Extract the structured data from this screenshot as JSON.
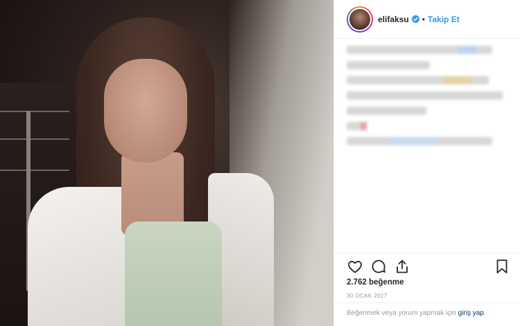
{
  "header": {
    "username": "elifaksu",
    "follow_label": "Takip Et",
    "separator": "•"
  },
  "footer": {
    "likes": "2.762 beğenme",
    "date": "30 OCAK 2017",
    "login_prefix": "Beğenmek veya yorum yapmak için",
    "login_link": "giriş yap",
    "login_suffix": "."
  },
  "icons": {
    "verified": "verified-badge-icon",
    "like": "heart-icon",
    "comment": "comment-icon",
    "share": "share-icon",
    "save": "bookmark-icon"
  },
  "colors": {
    "link": "#3897f0",
    "verified": "#3897f0",
    "muted": "#999999"
  }
}
